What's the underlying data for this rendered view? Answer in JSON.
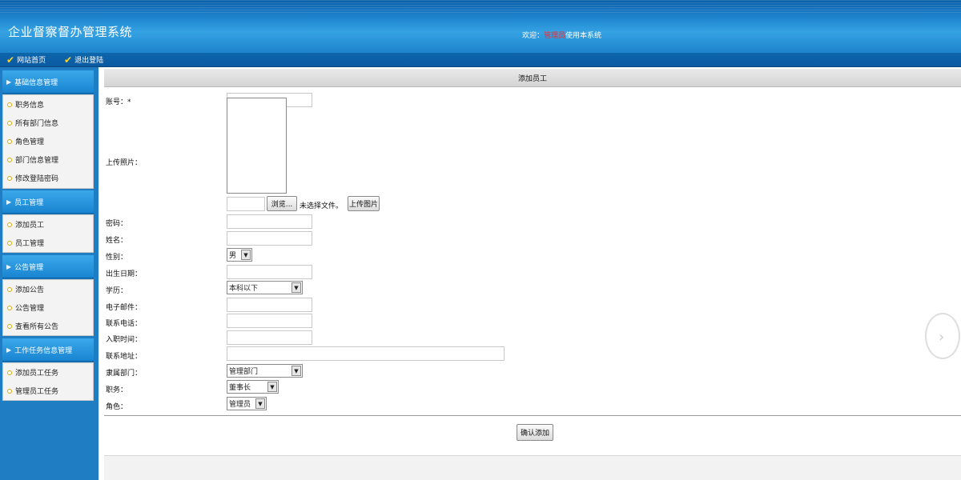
{
  "header": {
    "title": "企业督察督办管理系统",
    "welcome_prefix": "欢迎：",
    "role": "管理员",
    "welcome_suffix": "使用本系统"
  },
  "toolbar": {
    "home": "网站首页",
    "logout": "退出登陆"
  },
  "sidebar": {
    "groups": [
      {
        "title": "基础信息管理",
        "items": [
          "职务信息",
          "所有部门信息",
          "角色管理",
          "部门信息管理",
          "修改登陆密码"
        ]
      },
      {
        "title": "员工管理",
        "items": [
          "添加员工",
          "员工管理"
        ]
      },
      {
        "title": "公告管理",
        "items": [
          "添加公告",
          "公告管理",
          "查看所有公告"
        ]
      },
      {
        "title": "工作任务信息管理",
        "items": [
          "添加员工任务",
          "管理员工任务"
        ]
      }
    ]
  },
  "form": {
    "heading": "添加员工",
    "fields": {
      "account": "账号：*",
      "upload_photo": "上传照片：",
      "password": "密码：",
      "name": "姓名：",
      "gender": "性别：",
      "birthday": "出生日期：",
      "education": "学历：",
      "email": "电子邮件：",
      "phone": "联系电话：",
      "hire_date": "入职时间：",
      "address": "联系地址：",
      "department": "隶属部门：",
      "position": "职务：",
      "role": "角色："
    },
    "browse_button": "浏览...",
    "no_file": "未选择文件。",
    "upload_button": "上传图片",
    "gender_value": "男",
    "education_value": "本科以下",
    "department_value": "管理部门",
    "position_value": "董事长",
    "role_value": "管理员",
    "submit_button": "确认添加"
  },
  "icons": {
    "check": "check-icon",
    "triangle": "triangle-right-icon",
    "bullet": "circle-bullet-icon",
    "dropdown": "chevron-down-icon"
  }
}
